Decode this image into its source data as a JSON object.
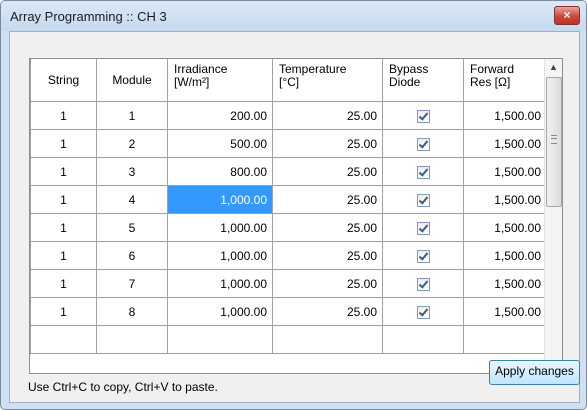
{
  "window": {
    "title": "Array Programming :: CH 3",
    "close_label": "×"
  },
  "table": {
    "headers": [
      {
        "line1": "String",
        "line2": ""
      },
      {
        "line1": "Module",
        "line2": ""
      },
      {
        "line1": "Irradiance",
        "line2": "[W/m²]"
      },
      {
        "line1": "Temperature",
        "line2": "[°C]"
      },
      {
        "line1": "Bypass",
        "line2": "Diode"
      },
      {
        "line1": "Forward",
        "line2": "Res [Ω]"
      }
    ],
    "rows": [
      {
        "string": "1",
        "module": "1",
        "irradiance": "200.00",
        "temperature": "25.00",
        "bypass": true,
        "forward_res": "1,500.00"
      },
      {
        "string": "1",
        "module": "2",
        "irradiance": "500.00",
        "temperature": "25.00",
        "bypass": true,
        "forward_res": "1,500.00"
      },
      {
        "string": "1",
        "module": "3",
        "irradiance": "800.00",
        "temperature": "25.00",
        "bypass": true,
        "forward_res": "1,500.00"
      },
      {
        "string": "1",
        "module": "4",
        "irradiance": "1,000.00",
        "temperature": "25.00",
        "bypass": true,
        "forward_res": "1,500.00",
        "selected_cell": "irradiance"
      },
      {
        "string": "1",
        "module": "5",
        "irradiance": "1,000.00",
        "temperature": "25.00",
        "bypass": true,
        "forward_res": "1,500.00"
      },
      {
        "string": "1",
        "module": "6",
        "irradiance": "1,000.00",
        "temperature": "25.00",
        "bypass": true,
        "forward_res": "1,500.00"
      },
      {
        "string": "1",
        "module": "7",
        "irradiance": "1,000.00",
        "temperature": "25.00",
        "bypass": true,
        "forward_res": "1,500.00"
      },
      {
        "string": "1",
        "module": "8",
        "irradiance": "1,000.00",
        "temperature": "25.00",
        "bypass": true,
        "forward_res": "1,500.00"
      }
    ]
  },
  "footer": {
    "hint": "Use Ctrl+C to copy, Ctrl+V to paste.",
    "apply_label": "Apply changes"
  },
  "icons": {
    "scroll_up": "triangle-up",
    "scroll_down": "triangle-down",
    "close": "close-icon"
  },
  "colors": {
    "selection": "#3399ff",
    "window_frame": "#cfe0f3",
    "close_button": "#c8463a"
  }
}
